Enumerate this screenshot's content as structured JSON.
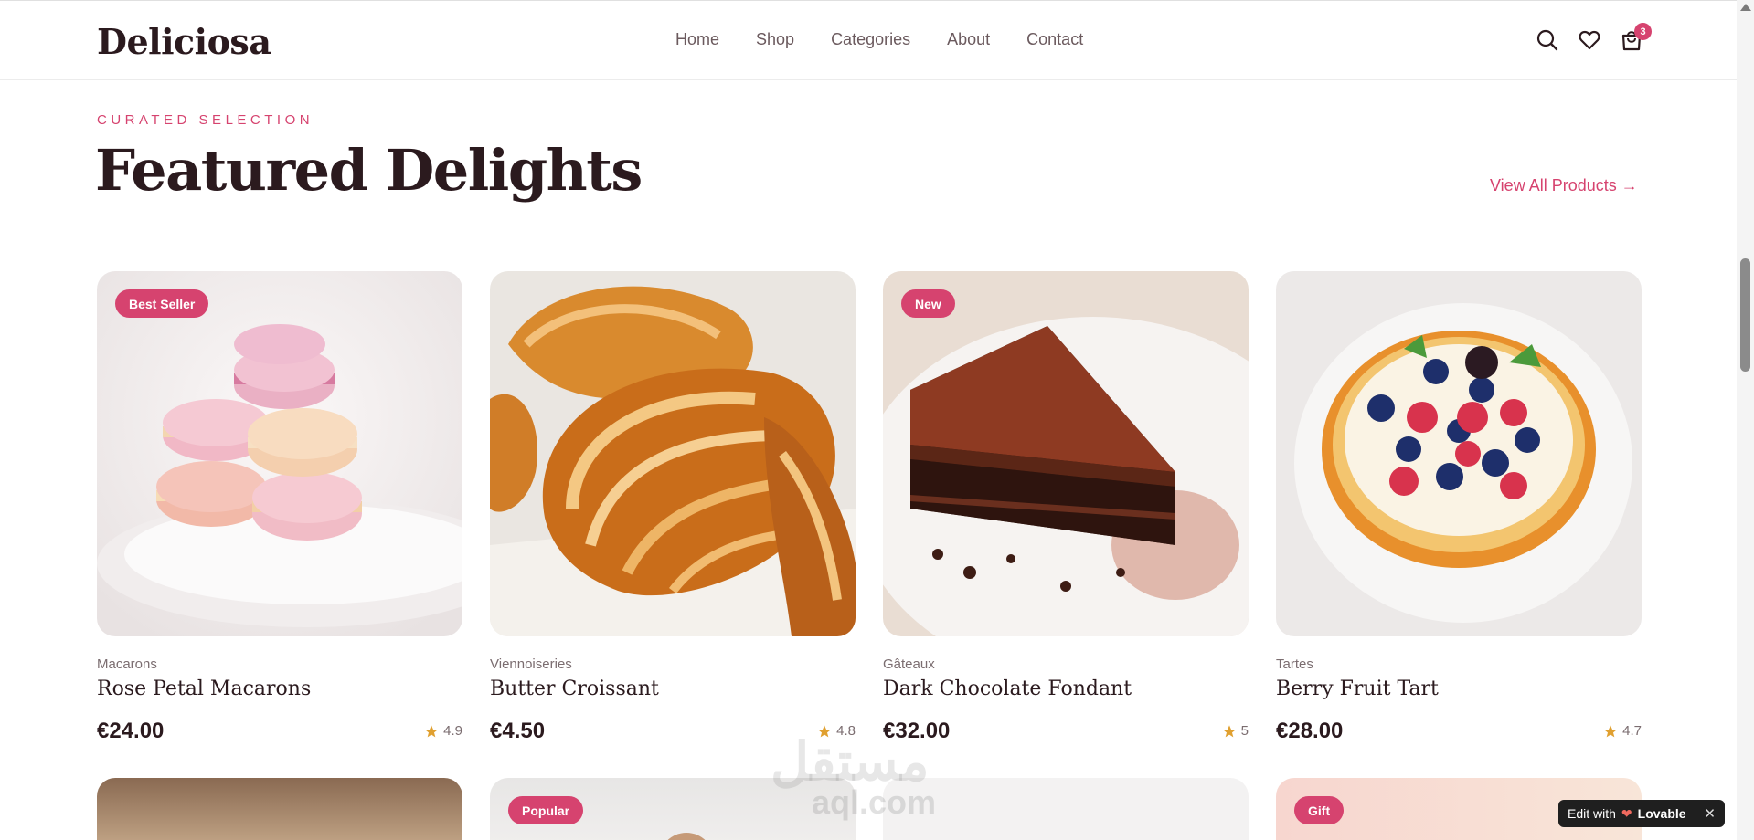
{
  "brand": "Deliciosa",
  "nav": [
    "Home",
    "Shop",
    "Categories",
    "About",
    "Contact"
  ],
  "cart_count": "3",
  "section": {
    "eyebrow": "CURATED SELECTION",
    "title": "Featured Delights",
    "view_all": "View All Products →"
  },
  "products": [
    {
      "badge": "Best Seller",
      "category": "Macarons",
      "name": "Rose Petal Macarons",
      "price": "€24.00",
      "rating": "4.9",
      "image": "macarons-image"
    },
    {
      "badge": "",
      "category": "Viennoiseries",
      "name": "Butter Croissant",
      "price": "€4.50",
      "rating": "4.8",
      "image": "croissant-image"
    },
    {
      "badge": "New",
      "category": "Gâteaux",
      "name": "Dark Chocolate Fondant",
      "price": "€32.00",
      "rating": "5",
      "image": "chocolate-cake-image"
    },
    {
      "badge": "",
      "category": "Tartes",
      "name": "Berry Fruit Tart",
      "price": "€28.00",
      "rating": "4.7",
      "image": "fruit-tart-image"
    }
  ],
  "row2_badges": [
    "",
    "Popular",
    "",
    "Gift"
  ],
  "lovable": {
    "prefix": "Edit with",
    "brand": "Lovable",
    "close": "✕"
  },
  "watermark": {
    "arabic": "مستقل",
    "latin": "aql.com"
  },
  "colors": {
    "accent": "#d6436f",
    "text": "#2b1a1e",
    "muted": "#7b6d70",
    "star": "#e0a030"
  }
}
